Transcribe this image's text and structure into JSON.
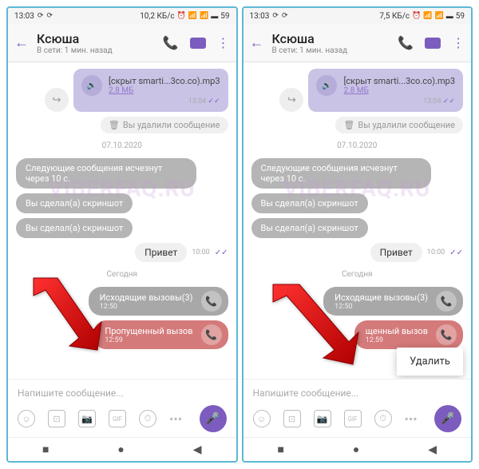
{
  "status": {
    "time": "13:03",
    "net_speed_left": "10,2 КБ/с",
    "net_speed_right": "7,5 КБ/с",
    "battery": "59"
  },
  "header": {
    "name": "Ксюша",
    "status": "В сети: 1 мин. назад"
  },
  "chat": {
    "audio_filename": "[скрыт smarti...3co.co).mp3",
    "audio_size": "2.8 МБ",
    "audio_time": "13:04",
    "deleted": "Вы удалили сообщение",
    "date1": "07.10.2020",
    "ephemeral": "Следующие сообщения исчезнут через 10 с.",
    "screenshot1": "Вы сделал(а) скриншот",
    "screenshot2": "Вы сделал(а) скриншот",
    "hello": "Привет",
    "hello_time": "10:00",
    "date2": "Сегодня",
    "outgoing_call": "Исходящие вызовы(3)",
    "outgoing_call_time": "12:50",
    "missed_call": "Пропущенный вызов",
    "missed_call_partial": "щенный вызов",
    "missed_call_time": "12:59"
  },
  "input": {
    "placeholder": "Напишите сообщение..."
  },
  "context": {
    "delete": "Удалить"
  },
  "watermark": "VIBERFAQ.RU"
}
